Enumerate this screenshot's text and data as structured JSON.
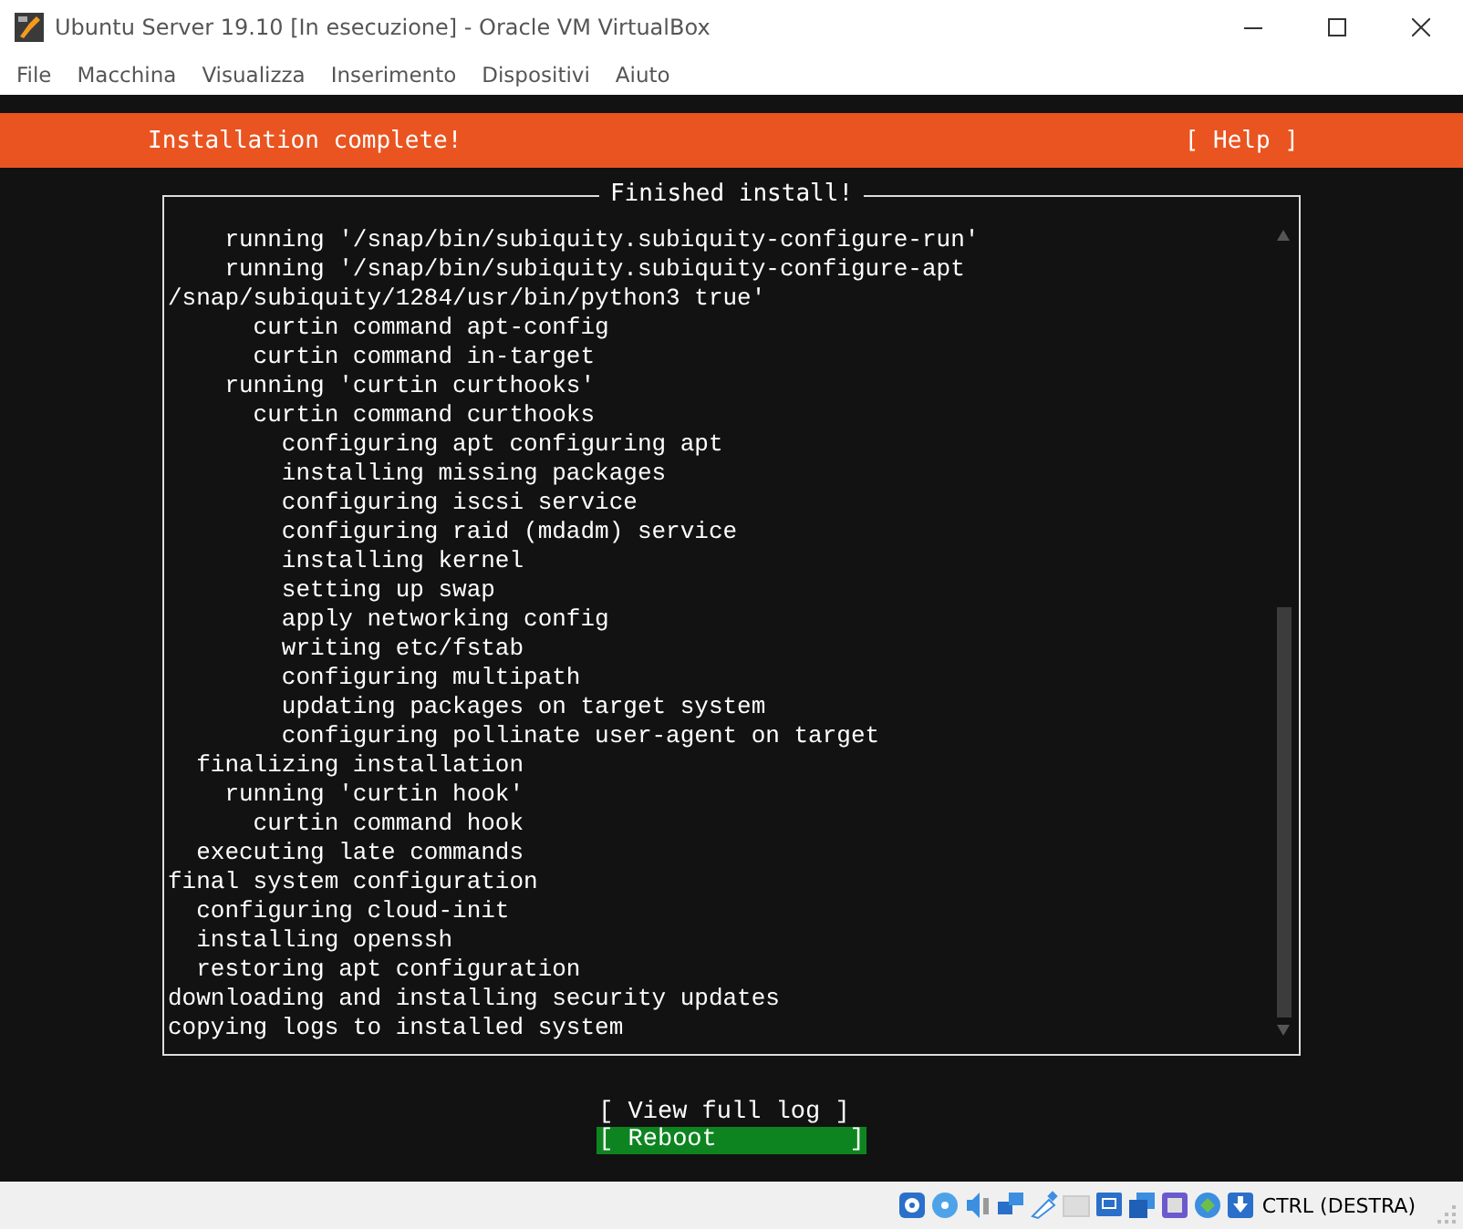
{
  "window": {
    "title": "Ubuntu Server 19.10 [In esecuzione] - Oracle VM VirtualBox"
  },
  "menu": [
    "File",
    "Macchina",
    "Visualizza",
    "Inserimento",
    "Dispositivi",
    "Aiuto"
  ],
  "header": {
    "title": "Installation complete!",
    "help": "[ Help ]"
  },
  "log": {
    "title": "Finished install!",
    "lines": [
      "    running '/snap/bin/subiquity.subiquity-configure-run'",
      "    running '/snap/bin/subiquity.subiquity-configure-apt",
      "/snap/subiquity/1284/usr/bin/python3 true'",
      "      curtin command apt-config",
      "      curtin command in-target",
      "    running 'curtin curthooks'",
      "      curtin command curthooks",
      "        configuring apt configuring apt",
      "        installing missing packages",
      "        configuring iscsi service",
      "        configuring raid (mdadm) service",
      "        installing kernel",
      "        setting up swap",
      "        apply networking config",
      "        writing etc/fstab",
      "        configuring multipath",
      "        updating packages on target system",
      "        configuring pollinate user-agent on target",
      "  finalizing installation",
      "    running 'curtin hook'",
      "      curtin command hook",
      "  executing late commands",
      "final system configuration",
      "  configuring cloud-init",
      "  installing openssh",
      "  restoring apt configuration",
      "downloading and installing security updates",
      "copying logs to installed system"
    ]
  },
  "buttons": [
    {
      "label": "[ View full log ]",
      "selected": false
    },
    {
      "label": "[ Reboot         ]",
      "selected": true
    }
  ],
  "status_bar": {
    "host_key": "CTRL (DESTRA)"
  }
}
